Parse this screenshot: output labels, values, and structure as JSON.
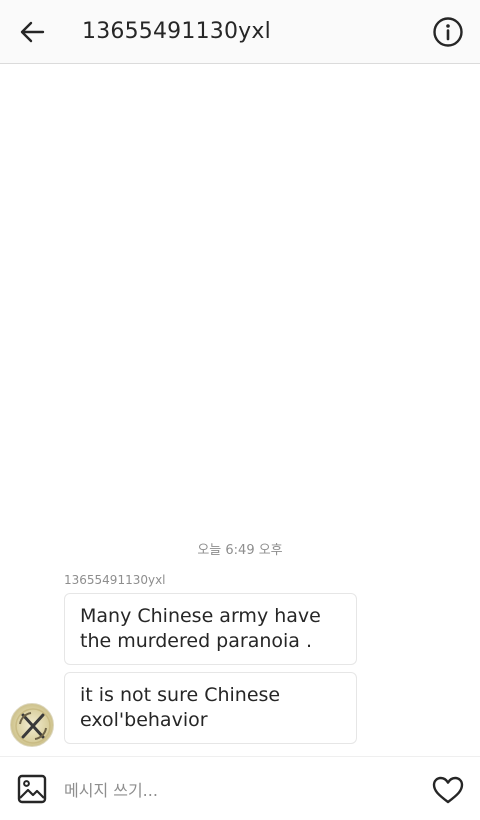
{
  "header": {
    "back_icon": "arrow-left-icon",
    "title": "13655491130yxl",
    "info_icon": "info-circle-icon"
  },
  "conversation": {
    "timestamp": "오늘 6:49 오후",
    "sender_name": "13655491130yxl",
    "messages": [
      {
        "text": "Many Chinese army have the murdered paranoia ."
      },
      {
        "text": "it is not sure Chinese exol'behavior"
      }
    ]
  },
  "composer": {
    "gallery_icon": "image-gallery-icon",
    "placeholder": "메시지 쓰기...",
    "value": "",
    "heart_icon": "heart-icon"
  }
}
